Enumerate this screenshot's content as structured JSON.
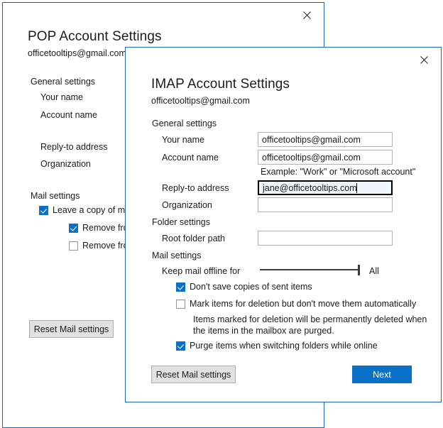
{
  "pop_dialog": {
    "title": "POP Account Settings",
    "subtitle": "officetooltips@gmail.com",
    "close_icon": "close-icon",
    "sections": {
      "general": "General settings",
      "mail": "Mail settings"
    },
    "labels": {
      "your_name": "Your name",
      "account_name": "Account name",
      "reply_to": "Reply-to address",
      "organization": "Organization"
    },
    "checkboxes": [
      {
        "label": "Leave a copy of me",
        "checked": true
      },
      {
        "label": "Remove fro",
        "checked": true
      },
      {
        "label": "Remove fro",
        "checked": false
      }
    ],
    "reset_button": "Reset Mail settings"
  },
  "imap_dialog": {
    "title": "IMAP Account Settings",
    "subtitle": "officetooltips@gmail.com",
    "close_icon": "close-icon",
    "sections": {
      "general": "General settings",
      "folder": "Folder settings",
      "mail": "Mail settings"
    },
    "fields": {
      "your_name": {
        "label": "Your name",
        "value": "officetooltips@gmail.com",
        "placeholder": ""
      },
      "account_name": {
        "label": "Account name",
        "value": "officetooltips@gmail.com",
        "placeholder": "",
        "hint": "Example: \"Work\" or \"Microsoft account\""
      },
      "reply_to": {
        "label": "Reply-to address",
        "value": "jane@officetooltips.com",
        "placeholder": "",
        "focused": true
      },
      "organization": {
        "label": "Organization",
        "value": "",
        "placeholder": ""
      },
      "root_folder_path": {
        "label": "Root folder path",
        "value": "",
        "placeholder": ""
      }
    },
    "slider": {
      "label": "Keep mail offline for",
      "value_label": "All",
      "percent": 100
    },
    "checkboxes": [
      {
        "label": "Don't save copies of sent items",
        "checked": true
      },
      {
        "label": "Mark items for deletion but don't move them automatically",
        "checked": false
      },
      {
        "label": "Purge items when switching folders while online",
        "checked": true
      }
    ],
    "note_line1": "Items marked for deletion will be permanently deleted when",
    "note_line2": "the items in the mailbox are purged.",
    "buttons": {
      "reset": "Reset Mail settings",
      "next": "Next"
    }
  },
  "colors": {
    "dialog_border": "#1b6ab2",
    "accent": "#0a71c8",
    "focus_bg": "#eff6fc",
    "button_face": "#e1e1e1",
    "text": "#1b1b1b"
  }
}
